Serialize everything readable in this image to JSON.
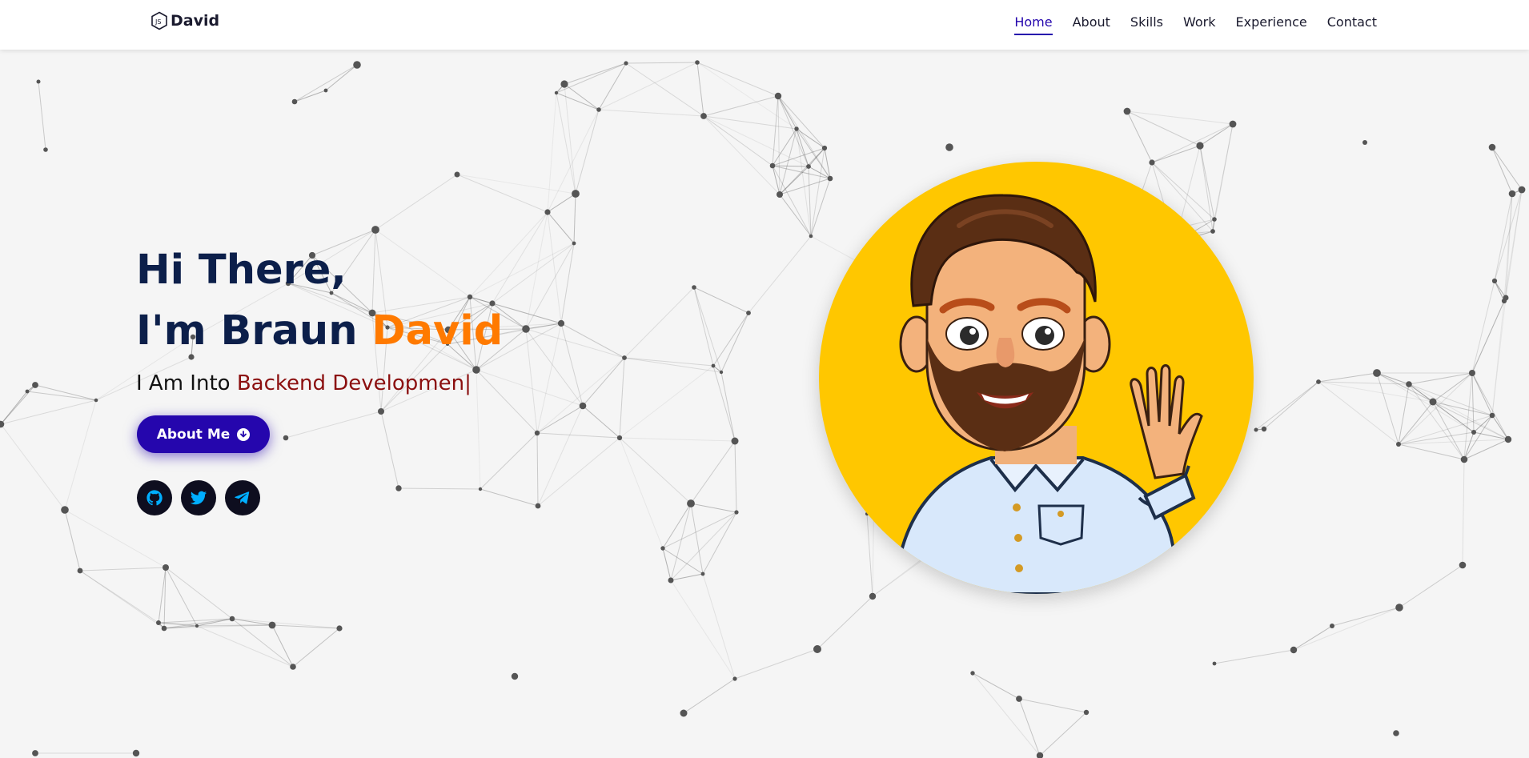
{
  "header": {
    "logo_text": "David",
    "nav": [
      {
        "label": "Home",
        "active": true
      },
      {
        "label": "About",
        "active": false
      },
      {
        "label": "Skills",
        "active": false
      },
      {
        "label": "Work",
        "active": false
      },
      {
        "label": "Experience",
        "active": false
      },
      {
        "label": "Contact",
        "active": false
      }
    ]
  },
  "hero": {
    "greeting": "Hi There,",
    "intro_prefix": "I'm Braun ",
    "intro_name": "David",
    "typed_prefix": "I Am Into ",
    "typed_text": "Backend Developmen|",
    "about_button": "About Me",
    "socials": [
      {
        "icon": "github-icon"
      },
      {
        "icon": "twitter-icon"
      },
      {
        "icon": "telegram-icon"
      }
    ]
  },
  "colors": {
    "primary": "#2506ad",
    "accent": "#ff7a00",
    "heading": "#0c1f4a",
    "typed": "#8b0f0f",
    "avatar_bg": "#ffc700",
    "social_icon": "#00aeff"
  }
}
